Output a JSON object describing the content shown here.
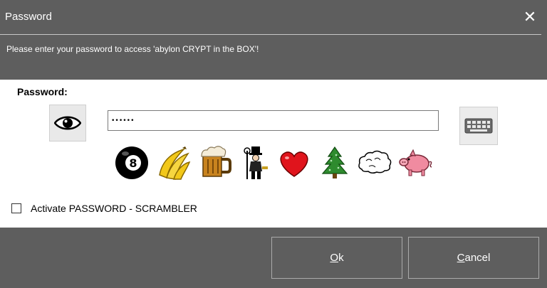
{
  "window": {
    "title": "Password",
    "close_glyph": "✕",
    "message": "Please enter your password to access 'abylon CRYPT in the BOX'!"
  },
  "form": {
    "password_label": "Password:",
    "password_mask": "••••••",
    "show_password_icon": "eye-icon",
    "keyboard_icon": "keyboard-icon"
  },
  "scrambler": {
    "icons": [
      "eight-ball",
      "bananas",
      "beer-mug",
      "chimney-sweep",
      "heart",
      "fir-tree",
      "cloud",
      "pig"
    ],
    "checkbox_label": "Activate PASSWORD - SCRAMBLER",
    "checked": false
  },
  "buttons": {
    "ok_mnemonic": "O",
    "ok_rest": "k",
    "cancel_mnemonic": "C",
    "cancel_rest": "ancel"
  },
  "colors": {
    "chrome": "#5e5e5e",
    "panel": "#ffffff",
    "heart": "#e0141c",
    "tree": "#2e8b2e",
    "pig": "#f08ba0",
    "banana": "#f2c81a"
  }
}
